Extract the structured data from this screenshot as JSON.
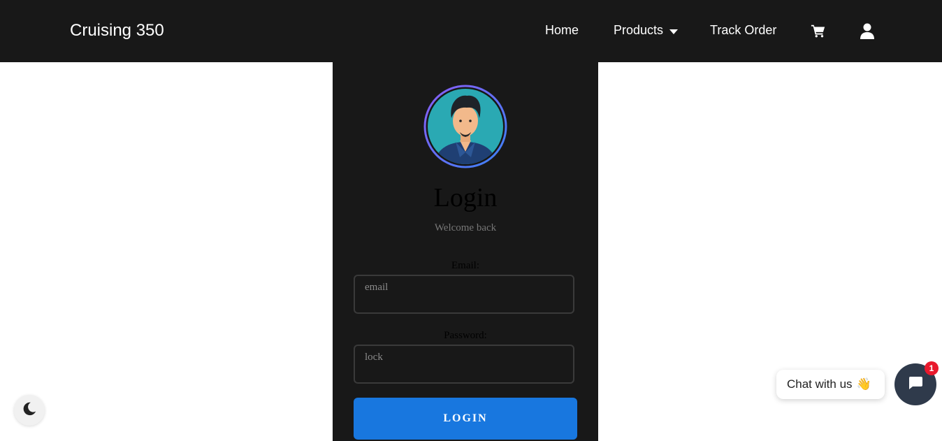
{
  "navbar": {
    "brand": "Cruising 350",
    "links": [
      "Home",
      "Products",
      "Track Order"
    ],
    "icons": [
      "cart-icon",
      "user-icon"
    ]
  },
  "login_card": {
    "avatar": "avatar-illustration",
    "title": "Login",
    "subtitle": "Welcome back",
    "email_label": "Email:",
    "email_value": "email",
    "password_label": "Password:",
    "password_value": "lock",
    "button_label": "LOGIN",
    "button_color": "#1877df"
  },
  "theme_toggle": {
    "icon": "moon-icon"
  },
  "chat": {
    "bubble_text": "Chat with us",
    "bubble_emoji": "👋",
    "badge_count": "1",
    "launcher_icon": "chat-icon"
  }
}
